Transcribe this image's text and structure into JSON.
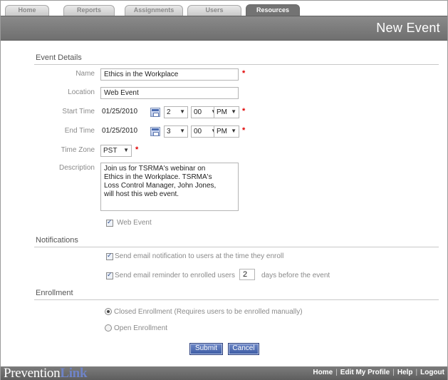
{
  "tabs": [
    {
      "label": "Home",
      "active": false
    },
    {
      "label": "Reports",
      "active": false
    },
    {
      "label": "Assignments",
      "active": false
    },
    {
      "label": "Users",
      "active": false
    },
    {
      "label": "Resources",
      "active": true
    }
  ],
  "page_title": "New Event",
  "event_details": {
    "section_title": "Event Details",
    "name_label": "Name",
    "name_value": "Ethics in the Workplace",
    "location_label": "Location",
    "location_value": "Web Event",
    "start_time_label": "Start Time",
    "start_date": "01/25/2010",
    "start_hour": "2",
    "start_minute": "00",
    "start_ampm": "PM",
    "end_time_label": "End Time",
    "end_date": "01/25/2010",
    "end_hour": "3",
    "end_minute": "00",
    "end_ampm": "PM",
    "timezone_label": "Time Zone",
    "timezone_value": "PST",
    "description_label": "Description",
    "description_value": "Join us for TSRMA's webinar on\nEthics in the Workplace. TSRMA's\nLoss Control Manager, John Jones,\nwill host this web event.",
    "web_event_label": "Web Event",
    "web_event_checked": true,
    "required_marker": "*"
  },
  "notifications": {
    "section_title": "Notifications",
    "enroll_email_label": "Send email notification to users at the time they enroll",
    "enroll_email_checked": true,
    "reminder_label_before": "Send email reminder to enrolled users",
    "reminder_days": "2",
    "reminder_label_after": "days before the event",
    "reminder_checked": true
  },
  "enrollment": {
    "section_title": "Enrollment",
    "closed_label": "Closed Enrollment (Requires users to be enrolled manually)",
    "open_label": "Open Enrollment",
    "selected": "closed"
  },
  "buttons": {
    "submit": "Submit",
    "cancel": "Cancel"
  },
  "footer": {
    "logo_prefix": "Prevention",
    "logo_suffix": "Link",
    "links": [
      "Home",
      "Edit My Profile",
      "Help",
      "Logout"
    ]
  },
  "colors": {
    "title_band": "#737373",
    "required": "#e00000",
    "button": "#3b5aa3",
    "logo_accent": "#6f84c8"
  }
}
